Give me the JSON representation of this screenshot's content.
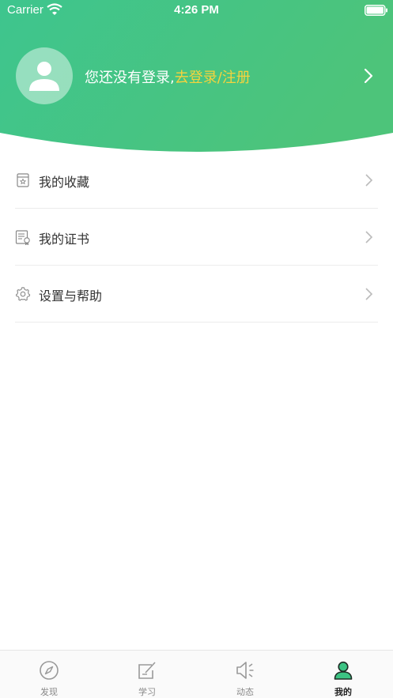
{
  "status_bar": {
    "carrier": "Carrier",
    "time": "4:26 PM"
  },
  "profile": {
    "prompt": "您还没有登录,",
    "login_link": "去登录/注册"
  },
  "menu": {
    "items": [
      {
        "label": "我的收藏",
        "icon": "bookmark-icon"
      },
      {
        "label": "我的证书",
        "icon": "certificate-icon"
      },
      {
        "label": "设置与帮助",
        "icon": "gear-icon"
      }
    ]
  },
  "tabbar": {
    "tabs": [
      {
        "label": "发现",
        "icon": "compass-icon",
        "active": false
      },
      {
        "label": "学习",
        "icon": "edit-icon",
        "active": false
      },
      {
        "label": "动态",
        "icon": "speaker-icon",
        "active": false
      },
      {
        "label": "我的",
        "icon": "person-icon",
        "active": true
      }
    ]
  },
  "colors": {
    "header_gradient_start": "#3ec58e",
    "header_gradient_end": "#4cc47a",
    "login_link": "#f5d33d",
    "active_tab_icon": "#3cc383"
  }
}
